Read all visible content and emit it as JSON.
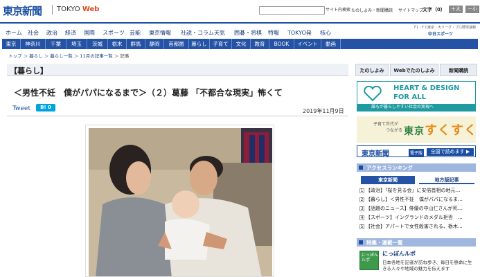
{
  "header": {
    "logo": "東京新聞",
    "logo_sub_prefix": "TOKYO",
    "logo_sub_accent": "Web",
    "search_button": "サイト内検索",
    "links": [
      "たのしよみ・新聞購読",
      "サイトマップ"
    ],
    "font_size_label": "文字（0）",
    "font_larger": "＋大",
    "font_smaller": "－小",
    "brand_right_top": "F1・F C東京・大リーグ・プロ野球速報",
    "brand_right_main": "中日スポーツ"
  },
  "nav_primary": [
    "ホーム",
    "社会",
    "政治",
    "経済",
    "国際",
    "スポーツ",
    "芸能",
    "東京情報",
    "社説・コラム",
    "天気",
    "囲碁・将棋",
    "特報",
    "TOKYO発",
    "核心"
  ],
  "nav_secondary": [
    "東京",
    "神奈川",
    "千葉",
    "埼玉",
    "茨城",
    "栃木",
    "群馬",
    "静岡",
    "首都圏",
    "暮らし",
    "子育て",
    "文化",
    "教育",
    "BOOK",
    "イベント",
    "動画"
  ],
  "breadcrumb": [
    "トップ",
    "暮らし",
    "暮らし一覧",
    "11月の記事一覧",
    "記事"
  ],
  "article": {
    "section": "【暮らし】",
    "headline": "＜男性不妊　僕がパパになるまで＞（２）葛藤 「不都合な現実」怖くて",
    "tweet": "Tweet",
    "hatena": "B! 0",
    "date": "2019年11月9日"
  },
  "sidebar": {
    "tabs": [
      "たのしよみ",
      "Webでたのしよみ",
      "新聞購読"
    ],
    "banner_heart_line1": "HEART & DESIGN",
    "banner_heart_line2": "FOR ALL",
    "banner_heart_sub": "誰もが暮らしやすい社会の実現へ",
    "banner_kosodate_1": "子育て世代が",
    "banner_kosodate_2": "つながる",
    "banner_kosodate_tokyo": "東京",
    "banner_kosodate_big": "すくすく",
    "banner_eshi_logo": "東京新聞",
    "banner_eshi_tag": "電子版",
    "banner_eshi_cta": "全国で読めます ▶",
    "ranking_title": "アクセスランキング",
    "ranking_tabs": [
      "東京新聞",
      "地方版記事"
    ],
    "ranking": [
      "【政治】「桜を見る会」に安倍首相の地元…",
      "【暮らし】＜男性不妊　僕がパパになるま…",
      "【話題のニュース】俳優の中山仁さんが死…",
      "【スポーツ】イングランドのメダル拒否　…",
      "【社会】アパートで女性殺害される、栃木…"
    ],
    "feature_title": "特集・連載一覧",
    "feature_icon_text": "にっぽんルポ",
    "feature_name": "にっぽんルポ",
    "feature_desc": "日本各地を記者が訪ね歩き、毎日を懸命に生きる人々や地域の魅力を伝えます"
  },
  "colors": {
    "brand_blue": "#1a4ea3",
    "nav_blue": "#2452a4",
    "accent_orange": "#e0451b",
    "teal": "#1e9aa0"
  }
}
